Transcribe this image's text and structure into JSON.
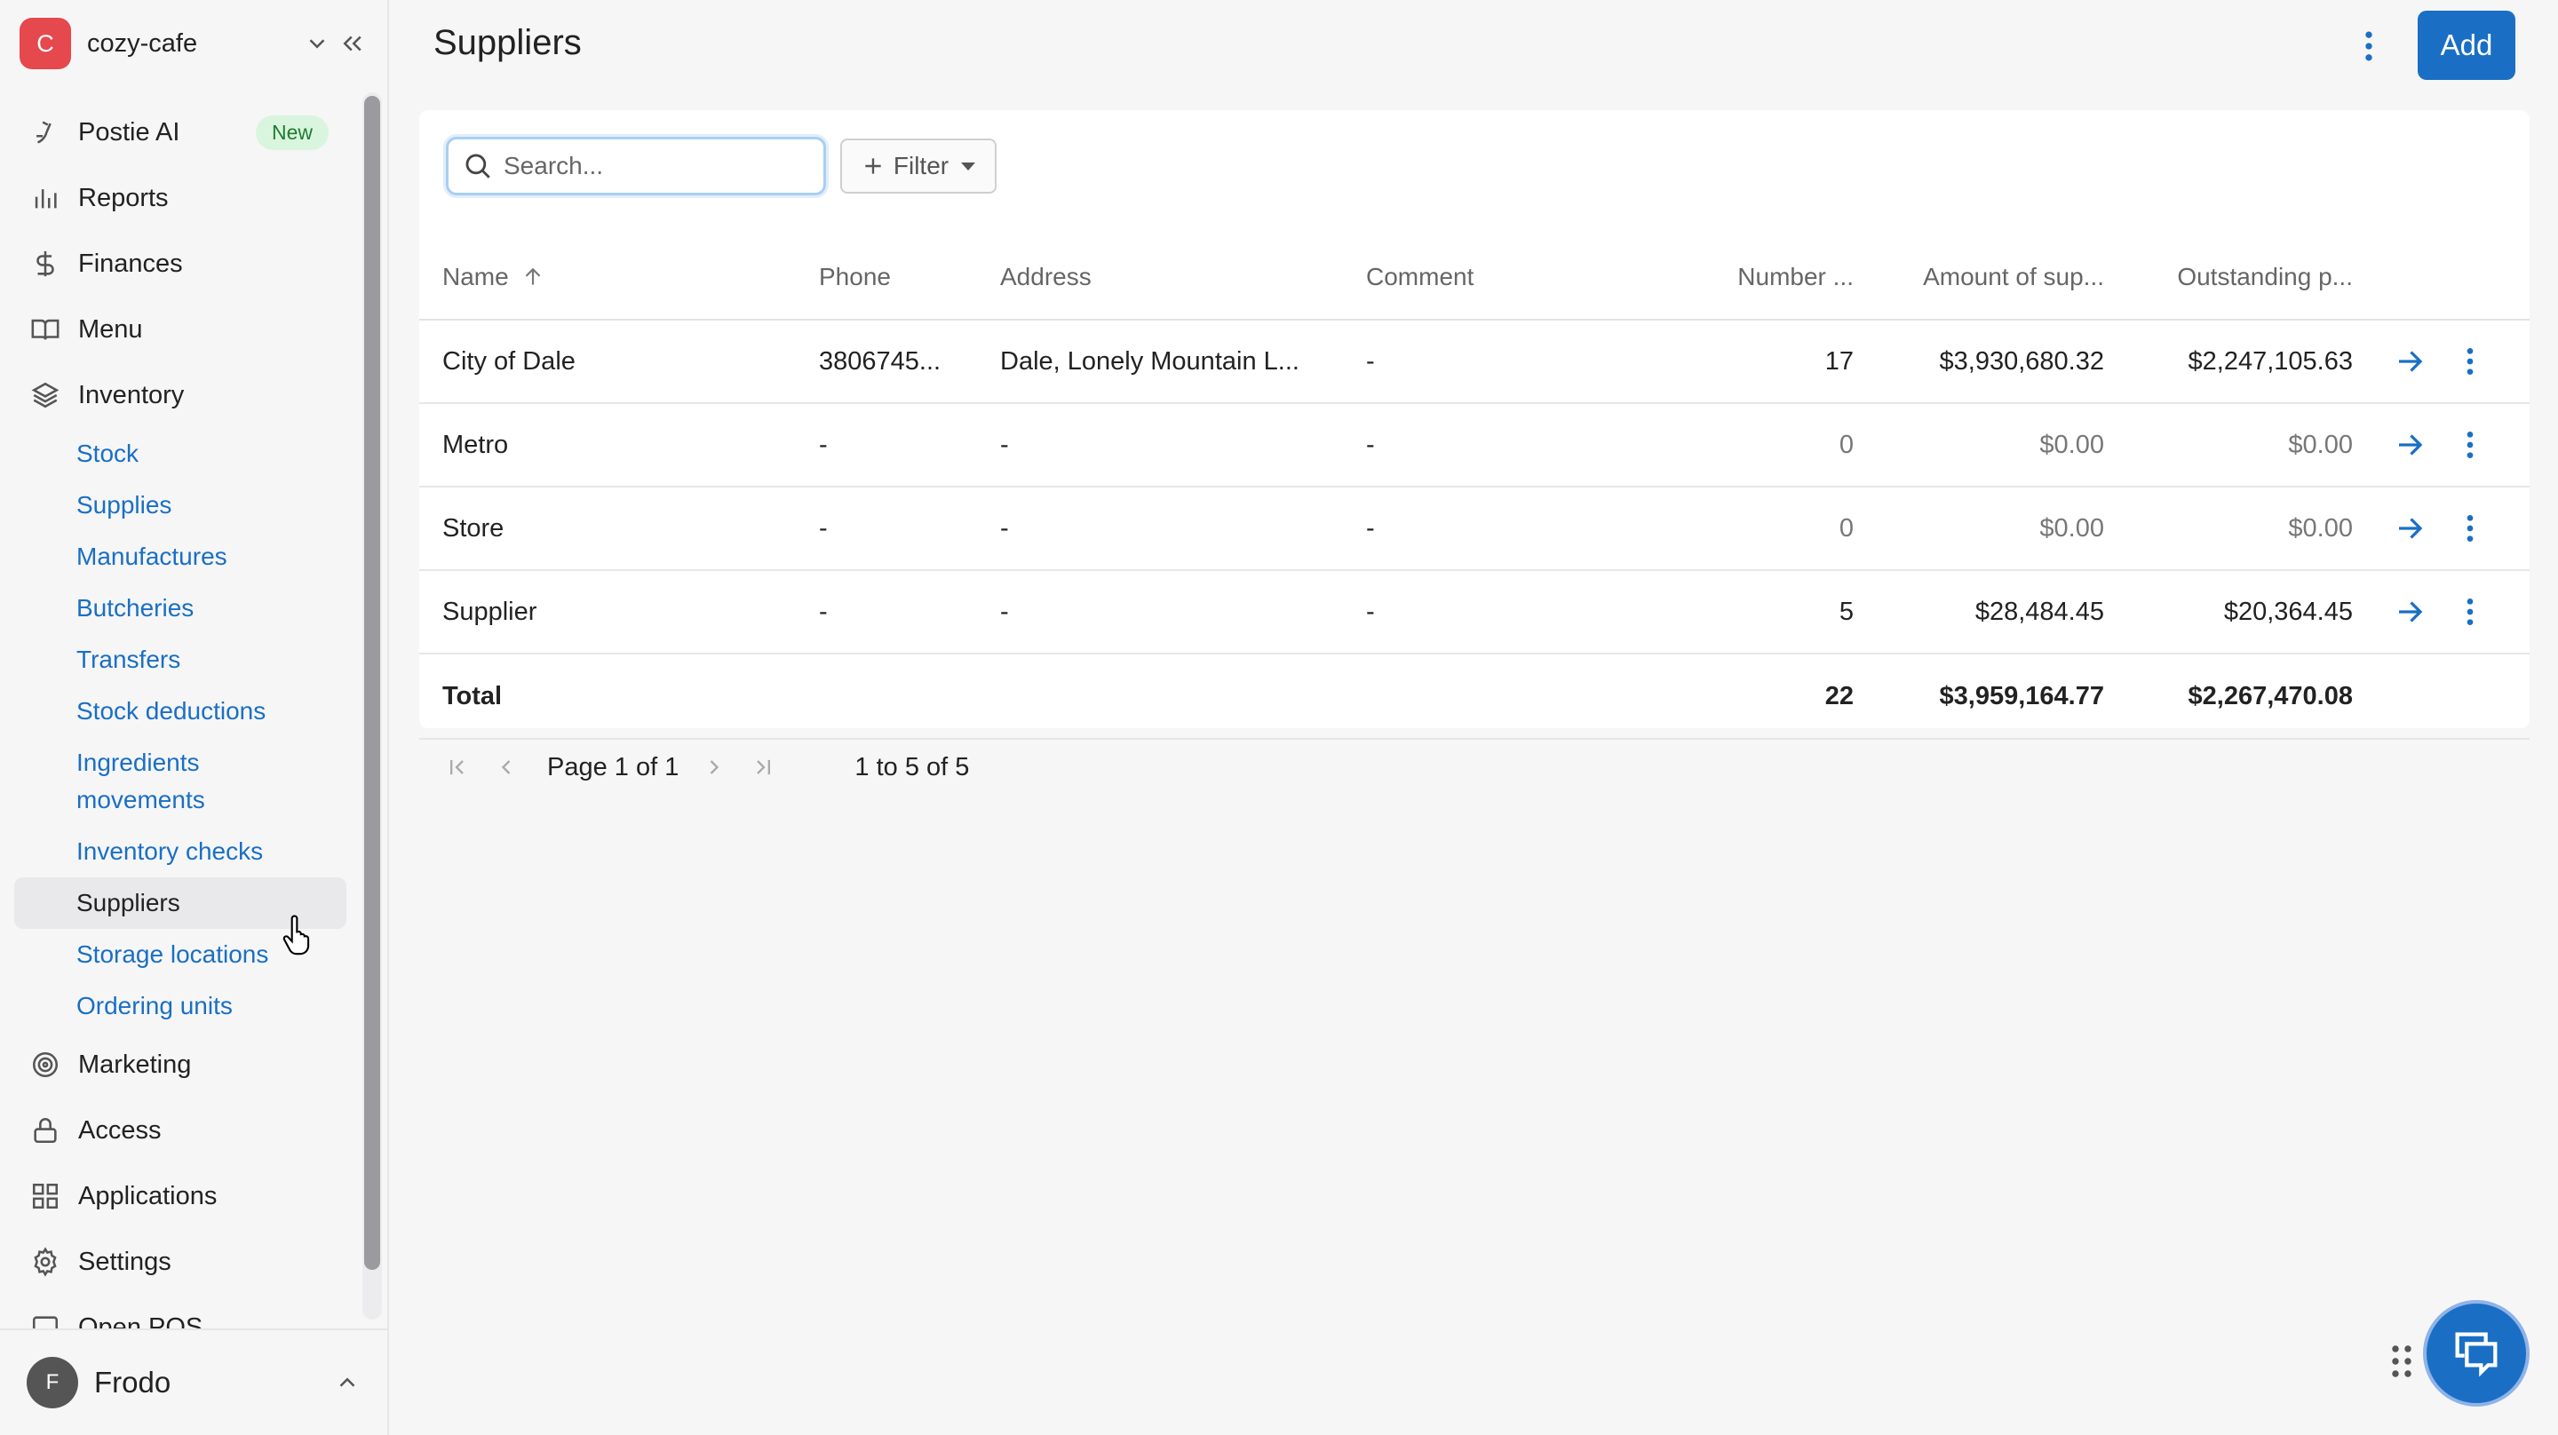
{
  "workspace": {
    "avatar_letter": "C",
    "name": "cozy-cafe"
  },
  "sidebar": {
    "items": [
      {
        "label": "Postie AI",
        "badge": "New",
        "icon": "postie-icon"
      },
      {
        "label": "Reports",
        "icon": "bar-chart-icon"
      },
      {
        "label": "Finances",
        "icon": "dollar-icon"
      },
      {
        "label": "Menu",
        "icon": "book-icon"
      },
      {
        "label": "Inventory",
        "icon": "layers-icon"
      }
    ],
    "inventory_sub": [
      {
        "label": "Stock"
      },
      {
        "label": "Supplies"
      },
      {
        "label": "Manufactures"
      },
      {
        "label": "Butcheries"
      },
      {
        "label": "Transfers"
      },
      {
        "label": "Stock deductions"
      },
      {
        "label": "Ingredients movements"
      },
      {
        "label": "Inventory checks"
      },
      {
        "label": "Suppliers"
      },
      {
        "label": "Storage locations"
      },
      {
        "label": "Ordering units"
      }
    ],
    "items_after": [
      {
        "label": "Marketing",
        "icon": "target-icon"
      },
      {
        "label": "Access",
        "icon": "lock-icon"
      },
      {
        "label": "Applications",
        "icon": "grid-icon"
      },
      {
        "label": "Settings",
        "icon": "gear-icon"
      },
      {
        "label": "Open POS",
        "icon": "monitor-icon"
      }
    ]
  },
  "user": {
    "avatar_letter": "F",
    "name": "Frodo"
  },
  "header": {
    "title": "Suppliers",
    "add_label": "Add"
  },
  "toolbar": {
    "search_placeholder": "Search...",
    "filter_label": "Filter"
  },
  "table": {
    "columns": [
      "Name",
      "Phone",
      "Address",
      "Comment",
      "Number ...",
      "Amount of sup...",
      "Outstanding p..."
    ],
    "rows": [
      {
        "name": "City of Dale",
        "phone": "3806745...",
        "address": "Dale, Lonely Mountain L...",
        "comment": "-",
        "number": "17",
        "amount": "$3,930,680.32",
        "outstanding": "$2,247,105.63"
      },
      {
        "name": "Metro",
        "phone": "-",
        "address": "-",
        "comment": "-",
        "number": "0",
        "amount": "$0.00",
        "outstanding": "$0.00"
      },
      {
        "name": "Store",
        "phone": "-",
        "address": "-",
        "comment": "-",
        "number": "0",
        "amount": "$0.00",
        "outstanding": "$0.00"
      },
      {
        "name": "Supplier",
        "phone": "-",
        "address": "-",
        "comment": "-",
        "number": "5",
        "amount": "$28,484.45",
        "outstanding": "$20,364.45"
      }
    ],
    "total": {
      "label": "Total",
      "number": "22",
      "amount": "$3,959,164.77",
      "outstanding": "$2,267,470.08"
    }
  },
  "pagination": {
    "page_word": "Page",
    "current": "1",
    "of_word": "of",
    "total": "1",
    "range": "1 to 5 of 5"
  },
  "colors": {
    "accent": "#1a6fc4",
    "brand": "#e5484d",
    "badge_bg": "#d9f5dd",
    "badge_text": "#1f7a33"
  }
}
